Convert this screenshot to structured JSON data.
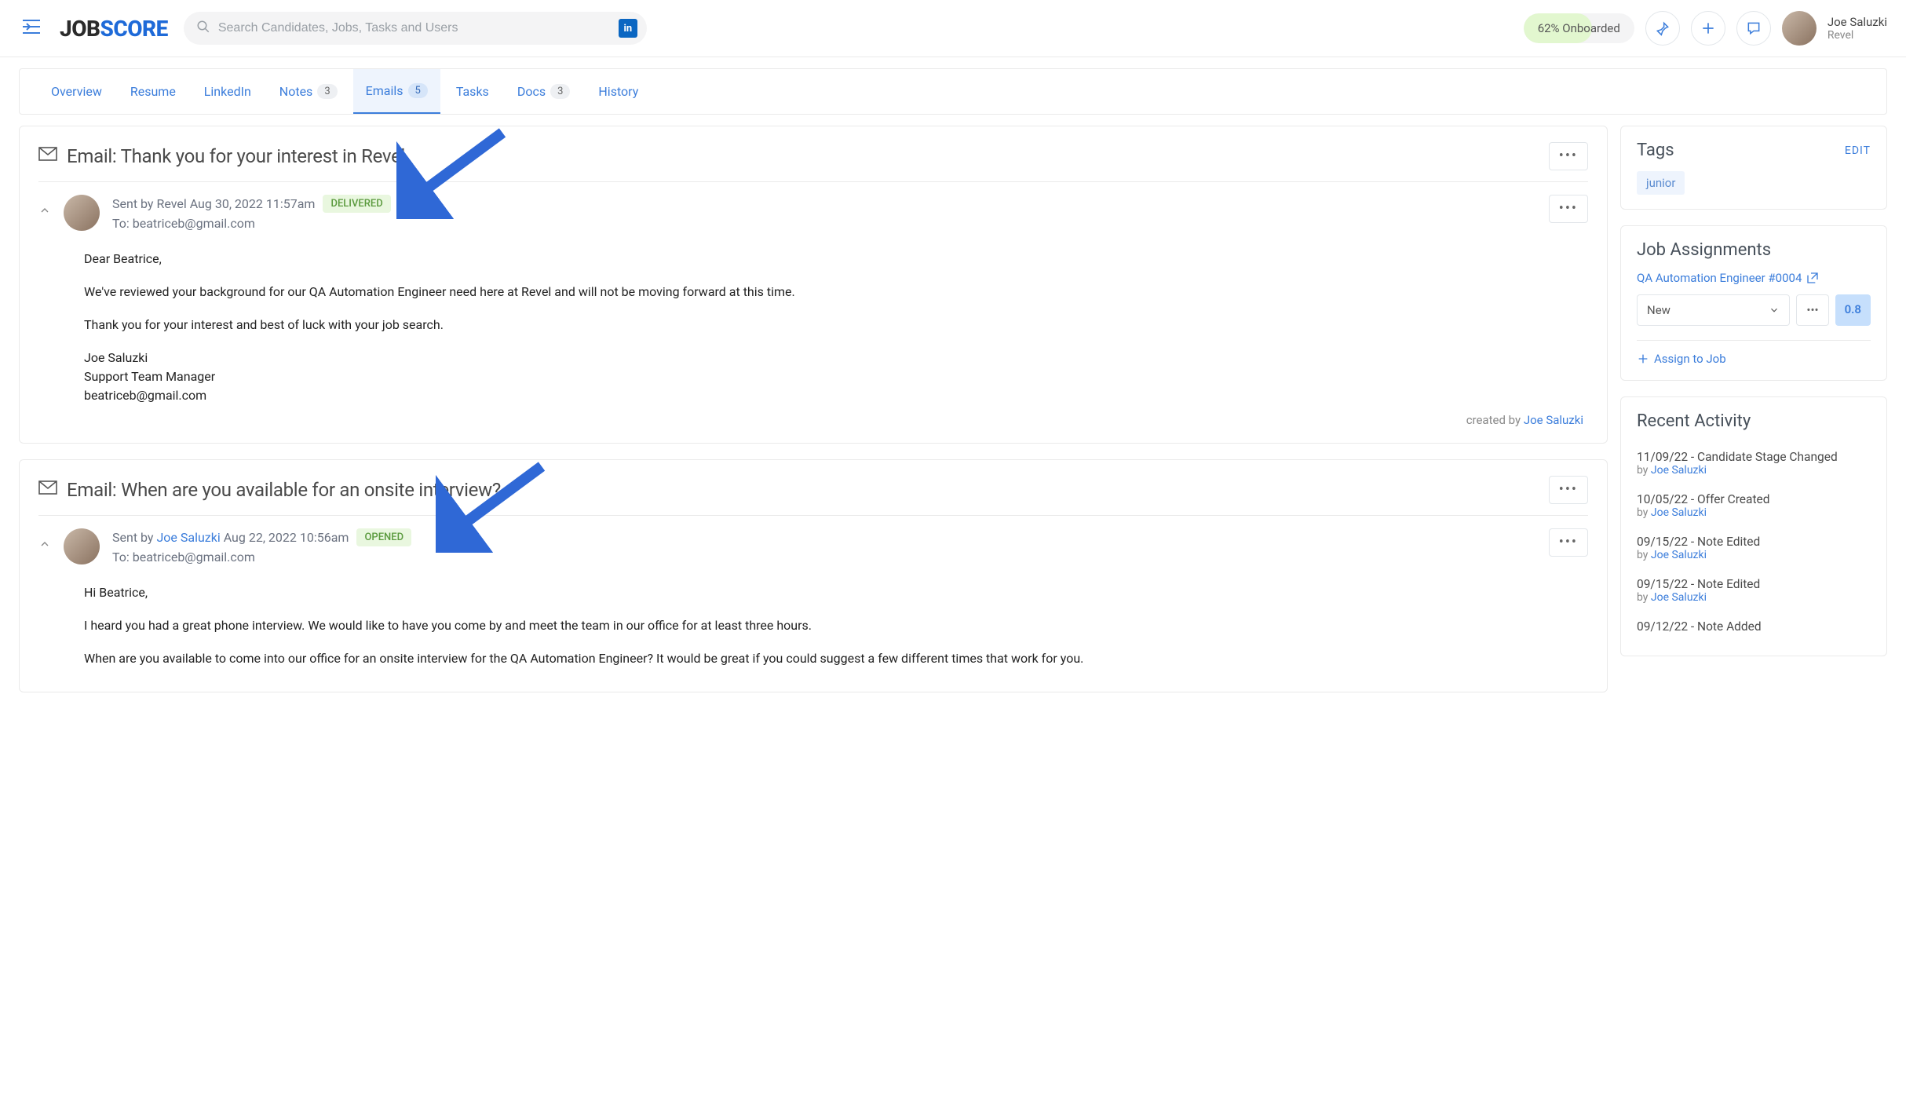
{
  "header": {
    "logo_job": "JOB",
    "logo_score": "SCORE",
    "search_placeholder": "Search Candidates, Jobs, Tasks and Users",
    "onboard_label": "62% Onboarded",
    "user_name": "Joe Saluzki",
    "user_org": "Revel"
  },
  "tabs": {
    "overview": "Overview",
    "resume": "Resume",
    "linkedin": "LinkedIn",
    "notes": "Notes",
    "notes_count": "3",
    "emails": "Emails",
    "emails_count": "5",
    "tasks": "Tasks",
    "docs": "Docs",
    "docs_count": "3",
    "history": "History"
  },
  "emails": [
    {
      "title": "Email: Thank you for your interest in Revel",
      "sent_prefix": "Sent by Revel",
      "sent_when": " Aug 30, 2022 11:57am",
      "status": "DELIVERED",
      "to_label": "To: beatriceb@gmail.com",
      "body": {
        "p1": "Dear Beatrice,",
        "p2": "We've reviewed your background for our QA Automation Engineer need here at Revel and will not be moving forward at this time.",
        "p3": "Thank you for your interest and best of luck with your job search.",
        "sig1": "Joe Saluzki",
        "sig2": "Support Team Manager",
        "sig3": "beatriceb@gmail.com"
      },
      "created_by_prefix": "created by ",
      "created_by_name": "Joe Saluzki"
    },
    {
      "title": "Email: When are you available for an onsite interview?",
      "sent_prefix": "Sent by ",
      "sent_by_link": "Joe Saluzki",
      "sent_when": " Aug 22, 2022 10:56am",
      "status": "OPENED",
      "to_label": "To: beatriceb@gmail.com",
      "body": {
        "p1": "Hi Beatrice,",
        "p2": "I heard you had a great phone interview. We would like to have you come by and meet the team in our office for at least three hours.",
        "p3": "When are you available to come into our office for an onsite interview for the QA Automation Engineer? It would be great if you could suggest a few different times that work for you."
      }
    }
  ],
  "sidebar": {
    "tags_title": "Tags",
    "tags_edit": "EDIT",
    "tag_junior": "junior",
    "jobs_title": "Job Assignments",
    "job_link": "QA Automation Engineer #0004",
    "job_stage": "New",
    "job_score": "0.8",
    "assign_label": "Assign to Job",
    "activity_title": "Recent Activity",
    "activity": [
      {
        "title": "11/09/22 - Candidate Stage Changed",
        "by_prefix": "by ",
        "by": "Joe Saluzki"
      },
      {
        "title": "10/05/22 - Offer Created",
        "by_prefix": "by ",
        "by": "Joe Saluzki"
      },
      {
        "title": "09/15/22 - Note Edited",
        "by_prefix": "by ",
        "by": "Joe Saluzki"
      },
      {
        "title": "09/15/22 - Note Edited",
        "by_prefix": "by ",
        "by": "Joe Saluzki"
      },
      {
        "title": "09/12/22 - Note Added"
      }
    ]
  }
}
